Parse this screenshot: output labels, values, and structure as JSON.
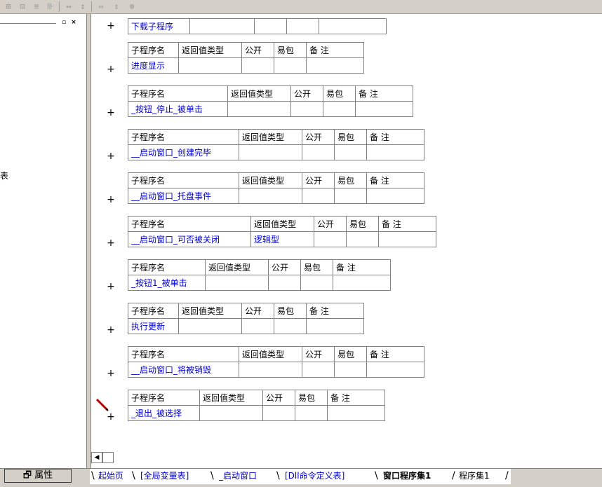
{
  "toolbar": {
    "icons": [
      "align-icon",
      "center-icon",
      "distribute-icon",
      "snap-icon",
      "horizontal-spacing-icon",
      "vertical-spacing-icon",
      "same-width-icon",
      "same-height-icon",
      "same-size-icon"
    ]
  },
  "left_panel": {
    "minimize_label": "▫",
    "close_label": "×",
    "visible_text": "表"
  },
  "code": {
    "first_row": {
      "name": "下载子程序"
    },
    "headers": {
      "name": "子程序名",
      "return_type": "返回值类型",
      "public": "公开",
      "easy_pack": "易包",
      "remark": "备 注"
    },
    "plus": "+",
    "subroutines": [
      {
        "name": "进度显示",
        "return_type": ""
      },
      {
        "name": "_按钮_停止_被单击",
        "return_type": ""
      },
      {
        "name": "__启动窗口_创建完毕",
        "return_type": ""
      },
      {
        "name": "__启动窗口_托盘事件",
        "return_type": ""
      },
      {
        "name": "__启动窗口_可否被关闭",
        "return_type": "逻辑型"
      },
      {
        "name": "_按钮1_被单击",
        "return_type": ""
      },
      {
        "name": "执行更新",
        "return_type": ""
      },
      {
        "name": "__启动窗口_将被销毁",
        "return_type": ""
      },
      {
        "name": "_退出_被选择",
        "return_type": ""
      }
    ]
  },
  "bottom": {
    "properties_label": "属性",
    "tabs": [
      {
        "label": "起始页",
        "active": false
      },
      {
        "label": "[全局变量表]",
        "active": false
      },
      {
        "label": "_启动窗口",
        "active": false
      },
      {
        "label": "[Dll命令定义表]",
        "active": false
      },
      {
        "label": "窗口程序集1",
        "active": true
      },
      {
        "label": "程序集1",
        "active": false
      }
    ]
  },
  "colors": {
    "link": "#0000cc",
    "chrome": "#d4d0c8",
    "grid": "#808080"
  }
}
